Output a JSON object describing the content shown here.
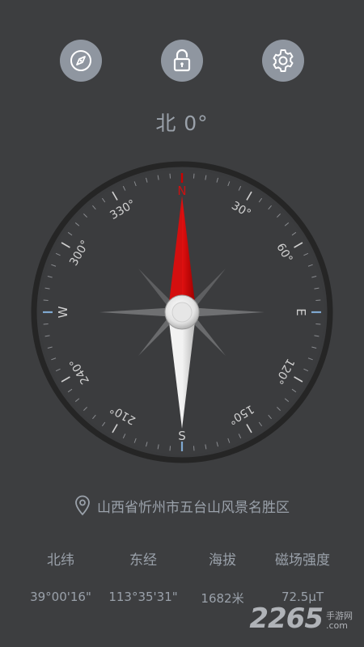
{
  "toolbar": {
    "compass_icon": "compass-icon",
    "lock_icon": "unlock-icon",
    "settings_icon": "gear-icon"
  },
  "heading": {
    "text": "北 0°",
    "degrees": 0
  },
  "dial": {
    "cardinals": {
      "n": "N",
      "e": "E",
      "s": "S",
      "w": "W"
    },
    "degree_labels": [
      "30°",
      "60°",
      "120°",
      "150°",
      "210°",
      "240°",
      "300°",
      "330°"
    ],
    "colors": {
      "needle_north": "#cc0000",
      "needle_south": "#e8e8e8",
      "accent_tick": "#7fa8d0",
      "ring": "#262626"
    }
  },
  "location": {
    "icon": "location-pin-icon",
    "text": "山西省忻州市五台山风景名胜区"
  },
  "stats": [
    {
      "label": "北纬",
      "value": "39°00'16\""
    },
    {
      "label": "东经",
      "value": "113°35'31\""
    },
    {
      "label": "海拔",
      "value": "1682米"
    },
    {
      "label": "磁场强度",
      "value": "72.5μT"
    }
  ],
  "watermark": {
    "number": "2265",
    "line1": "手游网",
    "line2": ".com"
  }
}
